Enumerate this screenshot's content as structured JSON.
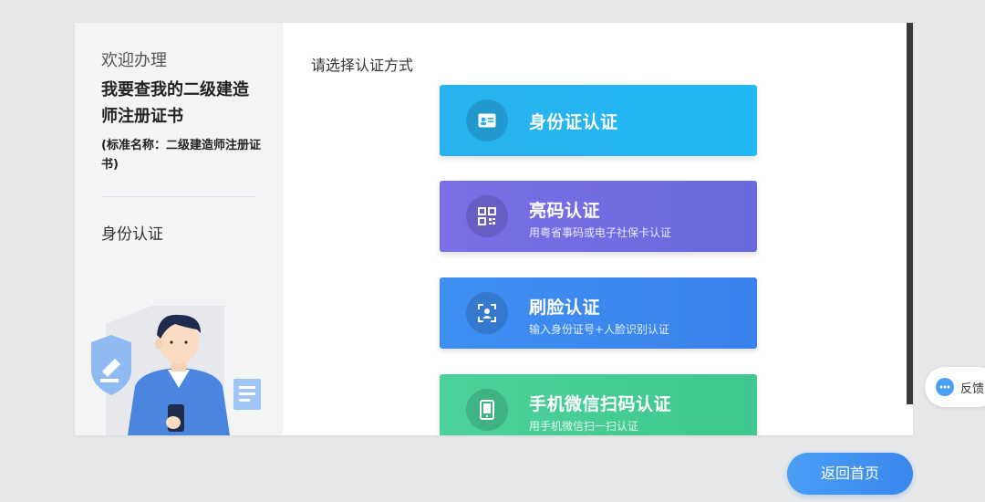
{
  "sidebar": {
    "welcome": "欢迎办理",
    "item_title": "我要查我的二级建造师注册证书",
    "standard_name": "(标准名称：二级建造师注册证书)",
    "current_step": "身份认证"
  },
  "main": {
    "prompt": "请选择认证方式",
    "methods": [
      {
        "title": "身份证认证",
        "subtitle": "",
        "icon": "id-card-icon"
      },
      {
        "title": "亮码认证",
        "subtitle": "用粤省事码或电子社保卡认证",
        "icon": "qr-code-icon"
      },
      {
        "title": "刷脸认证",
        "subtitle": "输入身份证号+人脸识别认证",
        "icon": "face-scan-icon"
      },
      {
        "title": "手机微信扫码认证",
        "subtitle": "用手机微信扫一扫认证",
        "icon": "phone-icon"
      }
    ]
  },
  "footer": {
    "home_button": "返回首页"
  },
  "feedback": {
    "label": "反馈"
  },
  "colors": {
    "id_card": "#28b1ef",
    "qr": "#7a6fe6",
    "face": "#3f8ff2",
    "wechat": "#4cd29a",
    "home": "#3a87ec"
  }
}
